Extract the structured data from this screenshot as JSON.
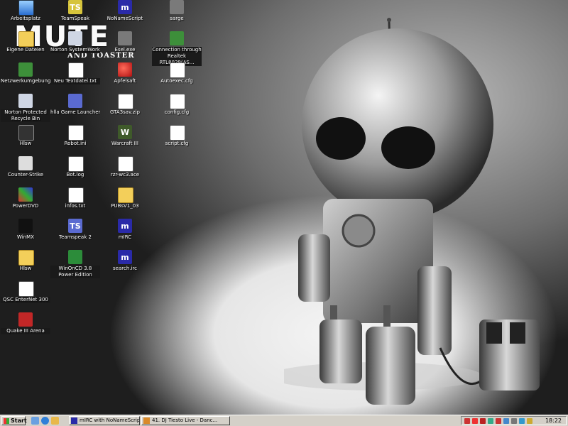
{
  "wallpaper": {
    "title": "MUTE",
    "subtitle": "AND TOASTER"
  },
  "icons": {
    "arbeitsplatz": "Arbeitsplatz",
    "eigene_dateien": "Eigene Dateien",
    "netzwerkumgebung": "Netzwerkumgebung",
    "norton_recycle": "Norton Protected Recycle Bin",
    "hlsw": "Hlsw",
    "counter_strike": "Counter-Strike",
    "powerdvd": "PowerDVD",
    "winmx": "WinMX",
    "hlsw_folder": "Hlsw",
    "qsc": "QSC EnterNet 300",
    "quake": "Quake III Arena",
    "teamspeak": "TeamSpeak",
    "norton_sw": "Norton SystemWorks",
    "neu_text": "Neu Textdatei.txt",
    "hlla": "hlla Game Launcher",
    "robot_ini": "Robot.ini",
    "bot_log": "Bot.log",
    "infos": "infos.txt",
    "teamspeak2": "Teamspeak 2",
    "winoncd": "WinOnCD 3.8 Power Edition",
    "nonamescript": "NoNameScript",
    "esel": "Esel.exe",
    "apfelsaft": "Apfelsaft",
    "gta3": "GTA3sav.zip",
    "warcraft": "Warcraft III",
    "rzr": "rzr-wc3.ace",
    "pubsv": "PUBsV1_03",
    "mirc": "mIRC",
    "search_irc": "search.irc",
    "sarge": "sarge",
    "connection": "Connection through Realtek RTL8029(AS...",
    "autoexec": "Autoexec.cfg",
    "config": "config.cfg",
    "script": "script.cfg"
  },
  "taskbar": {
    "start_label": "Start",
    "task1": "mIRC with NoNameScript[...",
    "task2": "41. DJ Tiesto Live - Danc...",
    "clock": "18:22"
  }
}
